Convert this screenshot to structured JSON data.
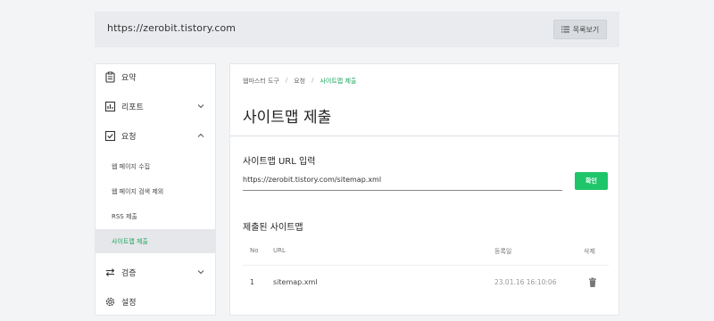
{
  "header": {
    "site_url": "https://zerobit.tistory.com",
    "list_button_label": "목록보기",
    "list_button_icon": "list-icon"
  },
  "sidebar": {
    "items": [
      {
        "label": "요약",
        "icon": "clipboard-icon"
      },
      {
        "label": "리포트",
        "icon": "bar-chart-icon",
        "expanded": false
      },
      {
        "label": "요청",
        "icon": "checkbox-icon",
        "expanded": true
      },
      {
        "label": "검증",
        "icon": "swap-arrows-icon",
        "expanded": false
      },
      {
        "label": "설정",
        "icon": "gear-icon"
      }
    ],
    "sub_items": [
      {
        "label": "웹 페이지 수집"
      },
      {
        "label": "웹 페이지 검색 제외"
      },
      {
        "label": "RSS 제출"
      },
      {
        "label": "사이트맵 제출",
        "active": true
      }
    ]
  },
  "main": {
    "breadcrumb": [
      "웹마스터 도구",
      "요청",
      "사이트맵 제출"
    ],
    "breadcrumb_separator": "/",
    "title": "사이트맵 제출",
    "url_section_label": "사이트맵 URL 입력",
    "url_input_value": "https://zerobit.tistory.com/sitemap.xml",
    "confirm_button_label": "확인",
    "submitted_section_label": "제출된 사이트맵",
    "table": {
      "columns": [
        "No",
        "URL",
        "등록일",
        "삭제"
      ],
      "rows": [
        {
          "no": "1",
          "url": "sitemap.xml",
          "date": "23.01.16 16:10:06"
        }
      ]
    }
  },
  "colors": {
    "accent_green": "#1fc56a",
    "active_text_green": "#1aa55b",
    "page_background": "#f3f4f6"
  }
}
